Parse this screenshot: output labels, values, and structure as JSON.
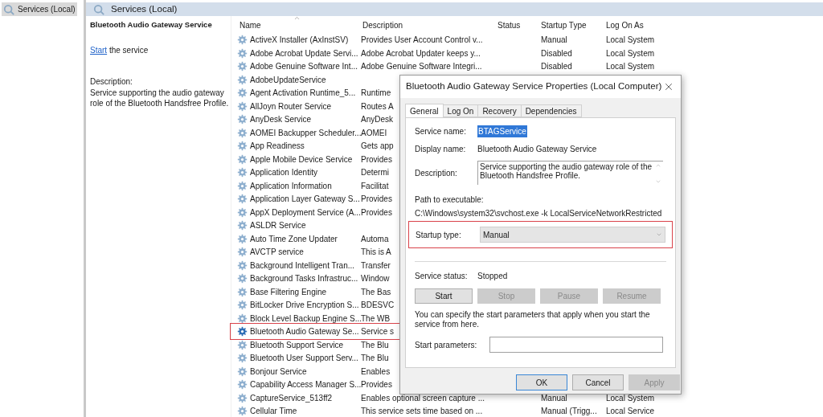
{
  "tree": {
    "items": [
      {
        "label": "Services (Local)",
        "selected": true
      }
    ]
  },
  "header": {
    "title": "Services (Local)"
  },
  "details": {
    "title": "Bluetooth Audio Gateway Service",
    "action_link": "Start",
    "action_rest": "the service",
    "description_label": "Description:",
    "description": "Service supporting the audio gateway role of the Bluetooth Handsfree Profile."
  },
  "table": {
    "columns": [
      "Name",
      "Description",
      "Status",
      "Startup Type",
      "Log On As"
    ],
    "rows": [
      {
        "name": "ActiveX Installer (AxInstSV)",
        "description": "Provides User Account Control v...",
        "startup_type": "Manual",
        "log_on_as": "Local System",
        "selected": false,
        "annotated": false
      },
      {
        "name": "Adobe Acrobat Update Servi...",
        "description": "Adobe Acrobat Updater keeps y...",
        "startup_type": "Disabled",
        "log_on_as": "Local System",
        "selected": false,
        "annotated": false
      },
      {
        "name": "Adobe Genuine Software Int...",
        "description": "Adobe Genuine Software Integri...",
        "startup_type": "Disabled",
        "log_on_as": "Local System",
        "selected": false,
        "annotated": false
      },
      {
        "name": "AdobeUpdateService",
        "selected": false,
        "annotated": false
      },
      {
        "name": "Agent Activation Runtime_5...",
        "description": "Runtime",
        "selected": false,
        "annotated": false
      },
      {
        "name": "AllJoyn Router Service",
        "description": "Routes A",
        "selected": false,
        "annotated": false
      },
      {
        "name": "AnyDesk Service",
        "description": "AnyDesk",
        "selected": false,
        "annotated": false
      },
      {
        "name": "AOMEI Backupper Scheduler...",
        "description": "AOMEI",
        "selected": false,
        "annotated": false
      },
      {
        "name": "App Readiness",
        "description": "Gets app",
        "selected": false,
        "annotated": false
      },
      {
        "name": "Apple Mobile Device Service",
        "description": "Provides",
        "selected": false,
        "annotated": false
      },
      {
        "name": "Application Identity",
        "description": "Determi",
        "selected": false,
        "annotated": false
      },
      {
        "name": "Application Information",
        "description": "Facilitat",
        "selected": false,
        "annotated": false
      },
      {
        "name": "Application Layer Gateway S...",
        "description": "Provides",
        "selected": false,
        "annotated": false
      },
      {
        "name": "AppX Deployment Service (A...",
        "description": "Provides",
        "selected": false,
        "annotated": false
      },
      {
        "name": "ASLDR Service",
        "selected": false,
        "annotated": false
      },
      {
        "name": "Auto Time Zone Updater",
        "description": "Automa",
        "selected": false,
        "annotated": false
      },
      {
        "name": "AVCTP service",
        "description": "This is A",
        "selected": false,
        "annotated": false
      },
      {
        "name": "Background Intelligent Tran...",
        "description": "Transfer",
        "selected": false,
        "annotated": false
      },
      {
        "name": "Background Tasks Infrastruc...",
        "description": "Window",
        "selected": false,
        "annotated": false
      },
      {
        "name": "Base Filtering Engine",
        "description": "The Bas",
        "selected": false,
        "annotated": false
      },
      {
        "name": "BitLocker Drive Encryption S...",
        "description": "BDESVC",
        "selected": false,
        "annotated": false
      },
      {
        "name": "Block Level Backup Engine S...",
        "description": "The WB",
        "selected": false,
        "annotated": false
      },
      {
        "name": "Bluetooth Audio Gateway Se...",
        "description": "Service s",
        "selected": true,
        "annotated": true
      },
      {
        "name": "Bluetooth Support Service",
        "description": "The Blu",
        "selected": false,
        "annotated": false
      },
      {
        "name": "Bluetooth User Support Serv...",
        "description": "The Blu",
        "selected": false,
        "annotated": false
      },
      {
        "name": "Bonjour Service",
        "description": "Enables",
        "selected": false,
        "annotated": false
      },
      {
        "name": "Capability Access Manager S...",
        "description": "Provides",
        "selected": false,
        "annotated": false
      },
      {
        "name": "CaptureService_513ff2",
        "description": "Enables optional screen capture ...",
        "startup_type": "Manual",
        "log_on_as": "Local System",
        "selected": false,
        "annotated": false
      },
      {
        "name": "Cellular Time",
        "description": "This service sets time based on ...",
        "startup_type": "Manual (Trigg...",
        "log_on_as": "Local Service",
        "selected": false,
        "annotated": false
      }
    ]
  },
  "dialog": {
    "title": "Bluetooth Audio Gateway Service Properties (Local Computer)",
    "tabs": [
      {
        "label": "General",
        "selected": true
      },
      {
        "label": "Log On",
        "selected": false
      },
      {
        "label": "Recovery",
        "selected": false
      },
      {
        "label": "Dependencies",
        "selected": false
      }
    ],
    "service_name": {
      "label": "Service name:",
      "value": "BTAGService",
      "text_selected": true
    },
    "display_name": {
      "label": "Display name:",
      "value": "Bluetooth Audio Gateway Service"
    },
    "description": {
      "label": "Description:",
      "value": "Service supporting the audio gateway role of the Bluetooth Handsfree Profile."
    },
    "path": {
      "label": "Path to executable:",
      "value": "C:\\Windows\\system32\\svchost.exe -k LocalServiceNetworkRestricted"
    },
    "startup_type": {
      "label": "Startup type:",
      "value": "Manual",
      "annotated": true
    },
    "service_status": {
      "label": "Service status:",
      "value": "Stopped"
    },
    "control_buttons": [
      {
        "label": "Start",
        "disabled": false
      },
      {
        "label": "Stop",
        "disabled": true
      },
      {
        "label": "Pause",
        "disabled": true
      },
      {
        "label": "Resume",
        "disabled": true
      }
    ],
    "hint": "You can specify the start parameters that apply when you start the service from here.",
    "start_parameters": {
      "label": "Start parameters:"
    },
    "buttons": [
      {
        "label": "OK",
        "default": true,
        "disabled": false
      },
      {
        "label": "Cancel",
        "default": false,
        "disabled": false
      },
      {
        "label": "Apply",
        "default": false,
        "disabled": true
      }
    ]
  }
}
